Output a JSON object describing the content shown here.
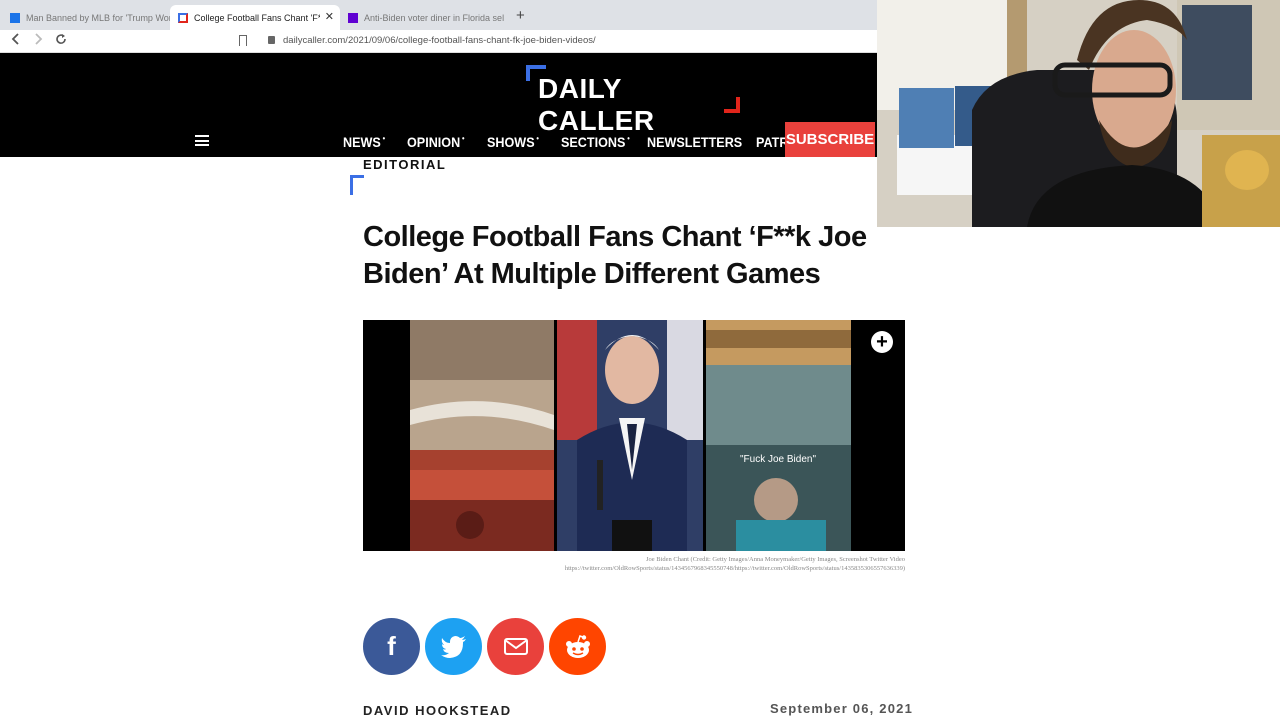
{
  "browser": {
    "tabs": [
      {
        "title": "Man Banned by MLB for 'Trump Won'",
        "active": false
      },
      {
        "title": "College Football Fans Chant 'F**k",
        "active": true
      },
      {
        "title": "Anti-Biden voter diner in Florida sells",
        "active": false
      }
    ],
    "new_tab_symbol": "+",
    "url": "dailycaller.com/2021/09/06/college-football-fans-chant-fk-joe-biden-videos/"
  },
  "site": {
    "logo_text": "DAILY CALLER",
    "nav": [
      {
        "label": "NEWS",
        "has_dropdown": true
      },
      {
        "label": "OPINION",
        "has_dropdown": true
      },
      {
        "label": "SHOWS",
        "has_dropdown": true
      },
      {
        "label": "SECTIONS",
        "has_dropdown": true
      },
      {
        "label": "NEWSLETTERS",
        "has_dropdown": false
      },
      {
        "label": "PATRIOTS",
        "has_dropdown": true
      }
    ],
    "subscribe_label": "SUBSCRIBE",
    "colors": {
      "header_bg": "#000000",
      "subscribe_bg": "#e9413c",
      "brand_blue": "#3b6fe5",
      "brand_red": "#e1251b"
    }
  },
  "article": {
    "kicker": "EDITORIAL",
    "headline": "College Football Fans Chant ‘F**k Joe Biden’ At Multiple Different Games",
    "image_overlay_text": "\"Fuck Joe Biden\"",
    "image_expand_symbol": "+",
    "caption_line1": "Joe Biden Chant (Credit: Getty Images/Anna Moneymaker/Getty Images, Screenshot Twitter Video",
    "caption_line2": "https://twitter.com/OldRowSports/status/1434567968345550748/https://twitter.com/OldRowSports/status/1435835306557636339)",
    "share": [
      {
        "network": "facebook",
        "glyph": "f",
        "color": "#3b5998"
      },
      {
        "network": "twitter",
        "glyph": "t",
        "color": "#1da1f2"
      },
      {
        "network": "email",
        "glyph": "✉",
        "color": "#e9413c"
      },
      {
        "network": "reddit",
        "glyph": "●",
        "color": "#ff4500"
      }
    ],
    "author": "DAVID HOOKSTEAD",
    "date": "September 06, 2021"
  }
}
